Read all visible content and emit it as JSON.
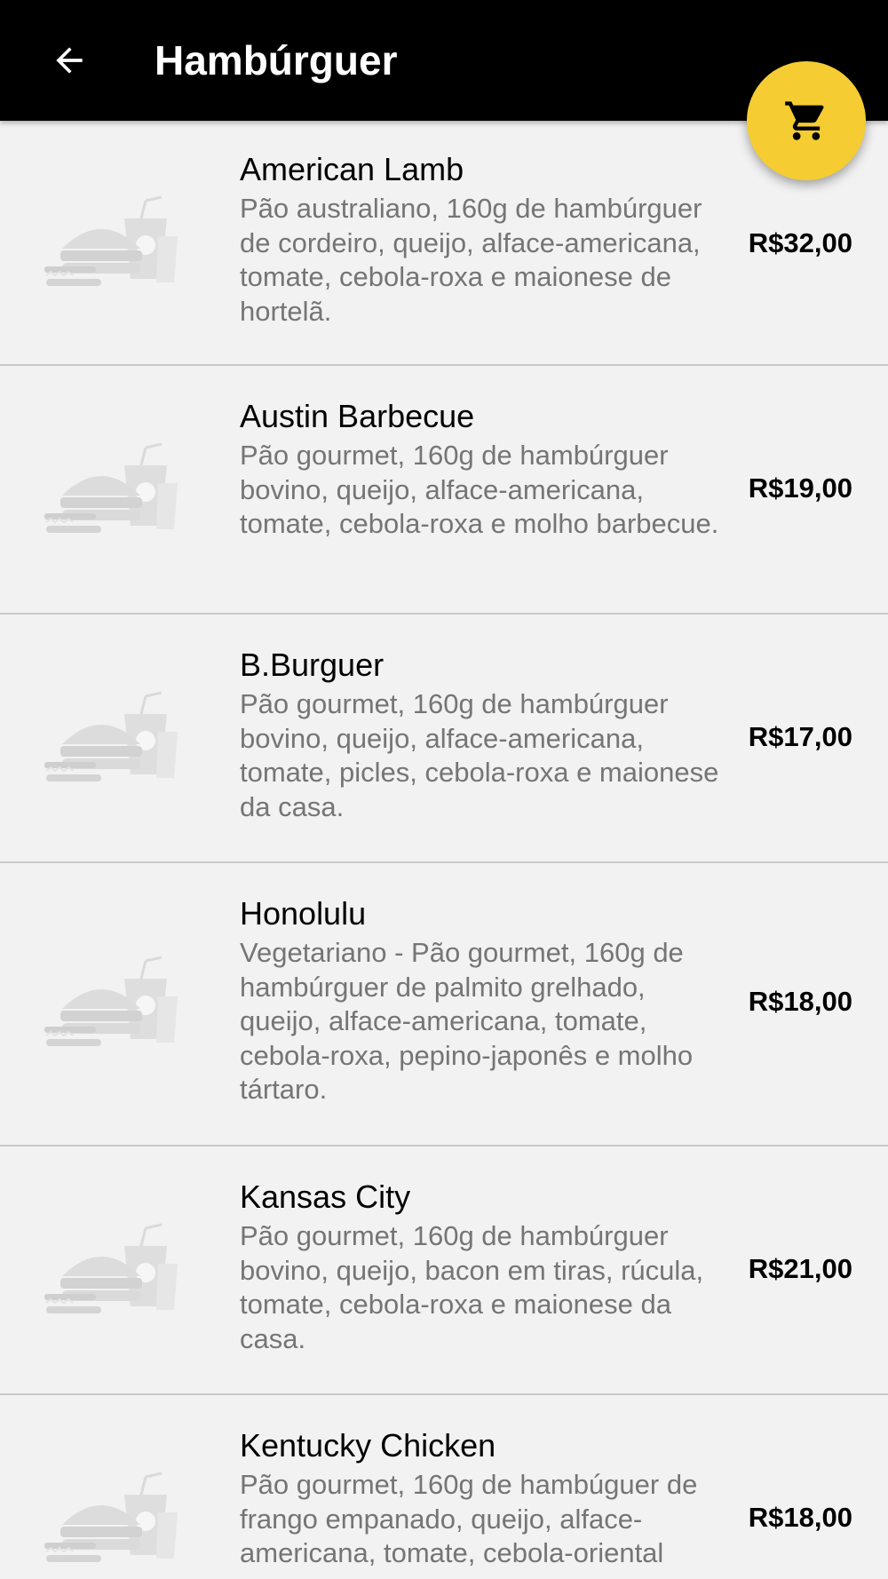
{
  "toolbar": {
    "title": "Hambúrguer",
    "back_icon": "arrow-back-icon",
    "background_color": "#000000"
  },
  "fab": {
    "icon": "shopping-cart-icon",
    "color": "#f5cd32"
  },
  "items": [
    {
      "name": "American Lamb",
      "description": "Pão australiano, 160g de hambúrguer de cordeiro, queijo, alface-americana, tomate, cebola-roxa e maionese de hortelã.",
      "price": "R$32,00",
      "image_icon": "food-placeholder-icon"
    },
    {
      "name": "Austin Barbecue",
      "description": "Pão gourmet, 160g de hambúrguer bovino, queijo, alface-americana, tomate, cebola-roxa e molho barbecue.",
      "price": "R$19,00",
      "image_icon": "food-placeholder-icon"
    },
    {
      "name": "B.Burguer",
      "description": "Pão gourmet, 160g de hambúrguer bovino, queijo, alface-americana, tomate, picles, cebola-roxa e maionese da casa.",
      "price": "R$17,00",
      "image_icon": "food-placeholder-icon"
    },
    {
      "name": "Honolulu",
      "description": "Vegetariano - Pão gourmet, 160g de hambúrguer de palmito grelhado, queijo, alface-americana, tomate, cebola-roxa, pepino-japonês e molho tártaro.",
      "price": "R$18,00",
      "image_icon": "food-placeholder-icon"
    },
    {
      "name": "Kansas City",
      "description": "Pão gourmet, 160g de hambúrguer bovino, queijo, bacon em tiras, rúcula, tomate, cebola-roxa e maionese da casa.",
      "price": "R$21,00",
      "image_icon": "food-placeholder-icon"
    },
    {
      "name": "Kentucky Chicken",
      "description": "Pão gourmet, 160g de hambúguer de frango empanado, queijo, alface-americana, tomate, cebola-oriental",
      "price": "R$18,00",
      "image_icon": "food-placeholder-icon"
    }
  ]
}
